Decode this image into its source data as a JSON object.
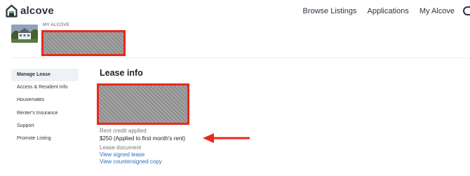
{
  "brand": {
    "name": "alcove",
    "color": "#2c3340"
  },
  "nav": {
    "items": [
      {
        "label": "Browse Listings"
      },
      {
        "label": "Applications"
      },
      {
        "label": "My Alcove"
      }
    ]
  },
  "property": {
    "eyebrow": "MY ALCOVE",
    "name_redacted": true
  },
  "sidebar": {
    "items": [
      {
        "label": "Manage Lease",
        "active": true
      },
      {
        "label": "Access & Resident Info"
      },
      {
        "label": "Housemates"
      },
      {
        "label": "Renter's Insurance"
      },
      {
        "label": "Support"
      },
      {
        "label": "Promote Listing"
      }
    ]
  },
  "main": {
    "title": "Lease info",
    "rent_credit": {
      "label": "Rent credit applied",
      "value": "$250 (Applied to first month's rent)"
    },
    "lease_document": {
      "label": "Lease document",
      "links": [
        {
          "label": "View signed lease"
        },
        {
          "label": "View countersigned copy"
        }
      ]
    }
  },
  "colors": {
    "annotation": "#e8291b",
    "link": "#2f6fb8",
    "active_bg": "#eef2f6"
  }
}
